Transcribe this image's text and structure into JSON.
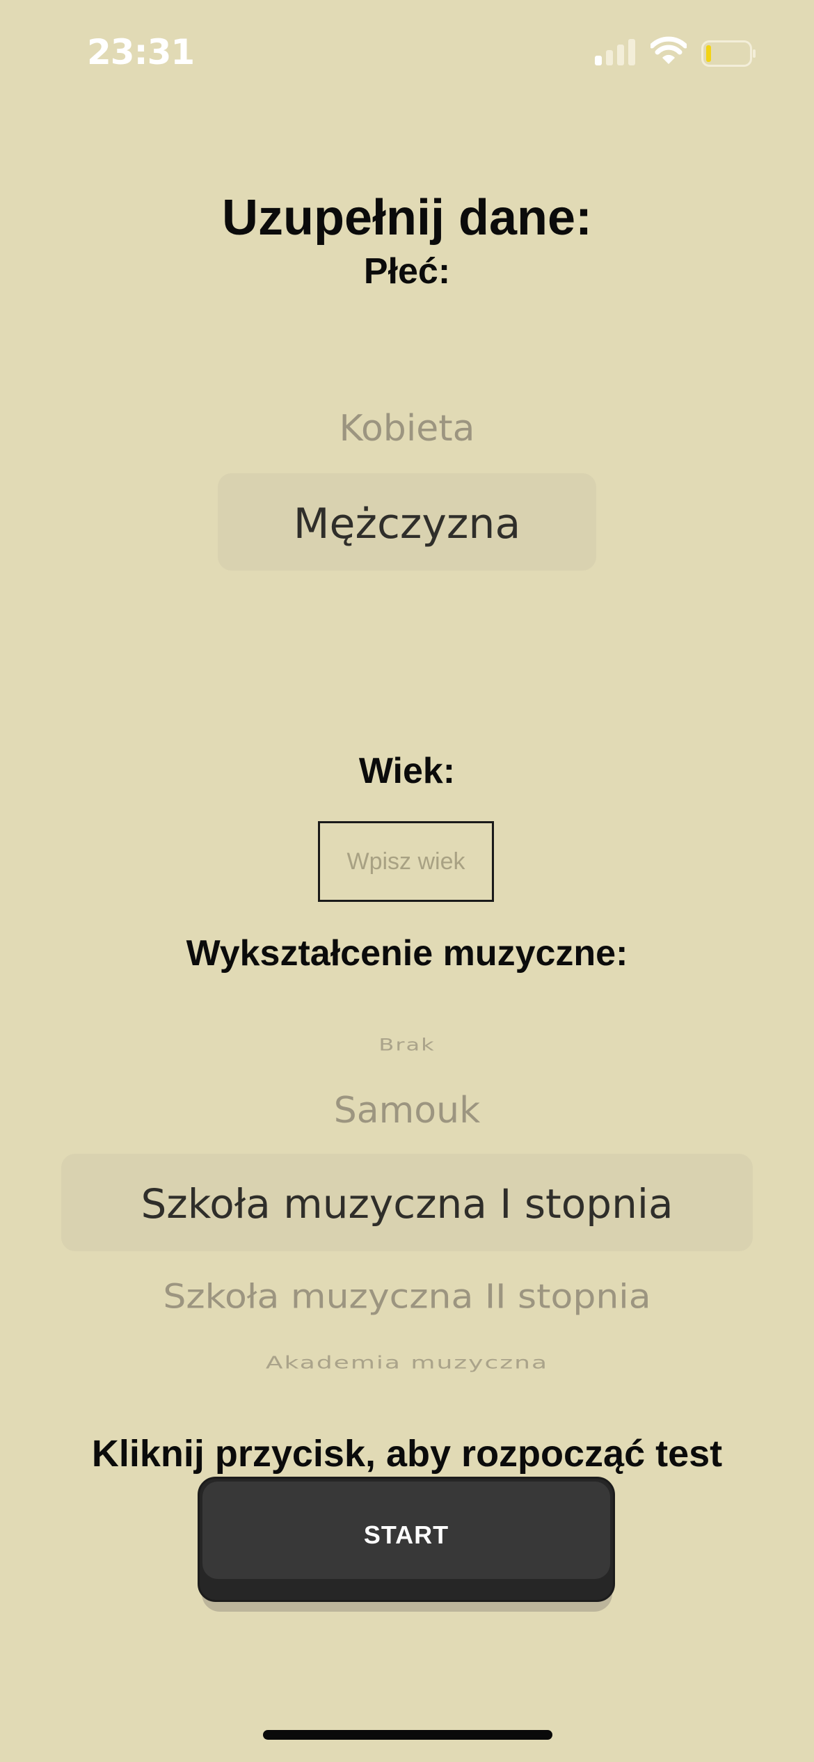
{
  "status_bar": {
    "time": "23:31",
    "icons": [
      "cellular-signal-icon",
      "wifi-icon",
      "battery-icon"
    ],
    "battery_color": "#f2d316"
  },
  "form": {
    "title": "Uzupełnij dane:",
    "gender_label": "Płeć:",
    "gender_picker": {
      "options": [
        "Kobieta",
        "Mężczyzna"
      ],
      "selected": "Mężczyzna"
    },
    "age_label": "Wiek:",
    "age_input": {
      "value": "",
      "placeholder": "Wpisz wiek"
    },
    "education_label": "Wykształcenie muzyczne:",
    "education_picker": {
      "options": [
        "Brak",
        "Samouk",
        "Szkoła muzyczna I stopnia",
        "Szkoła muzyczna II stopnia",
        "Akademia muzyczna"
      ],
      "selected": "Szkoła muzyczna I stopnia"
    }
  },
  "start": {
    "prompt": "Kliknij przycisk, aby rozpocząć test",
    "button_label": "START"
  },
  "colors": {
    "background": "#e1dab5",
    "button": "#383838",
    "picker_highlight": "#d9d2b0"
  }
}
